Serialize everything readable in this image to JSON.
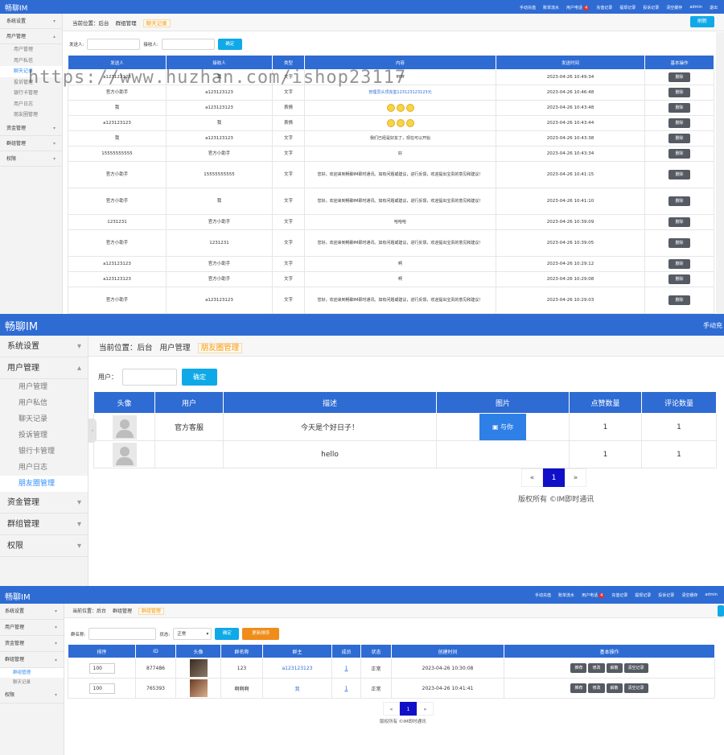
{
  "brand": "畅聊IM",
  "watermark": "https://www.huzhan.com/ishop23117",
  "nav": {
    "items": [
      "手动充值",
      "账单流水",
      "用户电话",
      "充值记录",
      "提现记录",
      "投诉记录",
      "清空缓存",
      "admin",
      "退出"
    ],
    "badge": "4"
  },
  "nav_short": "手动充",
  "s1": {
    "sidebar": {
      "group1": "系统设置",
      "group2": "用户管理",
      "items": [
        "用户管理",
        "用户私信",
        "聊天记录",
        "投诉管理",
        "银行卡管理",
        "用户日志",
        "朋友圈管理"
      ],
      "group3": "资金管理",
      "group4": "群组管理",
      "group5": "权限"
    },
    "crumb": [
      "当前位置：后台",
      "群组管理",
      "聊天记录"
    ],
    "refresh": "刷新",
    "filter": {
      "sender_label": "发送人:",
      "receiver_label": "接收人:",
      "confirm": "确定"
    },
    "headers": [
      "发送人",
      "接收人",
      "类型",
      "内容",
      "发送时间",
      "基本操作"
    ],
    "delete": "删除",
    "rows": [
      {
        "sender": "a123123123",
        "receiver": "我",
        "type": "文字",
        "content": "ffffff",
        "time": "2023-04-26 10:49:34"
      },
      {
        "sender": "官方小助手",
        "receiver": "a123123123",
        "type": "文字",
        "content": "管理员头顶完善123123123123元",
        "time": "2023-04-26 10:46:48"
      },
      {
        "sender": "我",
        "receiver": "a123123123",
        "type": "表情",
        "content": "",
        "time": "2023-04-26 10:43:48"
      },
      {
        "sender": "a123123123",
        "receiver": "我",
        "type": "表情",
        "content": "",
        "time": "2023-04-26 10:43:44"
      },
      {
        "sender": "我",
        "receiver": "a123123123",
        "type": "文字",
        "content": "我们已经是好友了，现在可以开始",
        "time": "2023-04-26 10:43:38"
      },
      {
        "sender": "15555555555",
        "receiver": "官方小助手",
        "type": "文字",
        "content": "好",
        "time": "2023-04-26 10:43:34"
      },
      {
        "sender": "官方小助手",
        "receiver": "15555555555",
        "type": "文字",
        "content": "您好，欢迎来到畅聊IM即时通讯。如有问题或建议，进行反馈，欢迎提出宝贵的意见和建议！",
        "time": "2023-04-26 10:41:15"
      },
      {
        "sender": "官方小助手",
        "receiver": "我",
        "type": "文字",
        "content": "您好，欢迎来到畅聊IM即时通讯。如有问题或建议，进行反馈，欢迎提出宝贵的意见和建议！",
        "time": "2023-04-26 10:41:10"
      },
      {
        "sender": "1231231",
        "receiver": "官方小助手",
        "type": "文字",
        "content": "哈哈哈",
        "time": "2023-04-26 10:39:09"
      },
      {
        "sender": "官方小助手",
        "receiver": "1231231",
        "type": "文字",
        "content": "您好，欢迎来到畅聊IM即时通讯。如有问题或建议，进行反馈，欢迎提出宝贵的意见和建议！",
        "time": "2023-04-26 10:39:05"
      },
      {
        "sender": "a123123123",
        "receiver": "官方小助手",
        "type": "文字",
        "content": "啊",
        "time": "2023-04-26 10:29:12"
      },
      {
        "sender": "a123123123",
        "receiver": "官方小助手",
        "type": "文字",
        "content": "啊",
        "time": "2023-04-26 10:29:08"
      },
      {
        "sender": "官方小助手",
        "receiver": "a123123123",
        "type": "文字",
        "content": "您好，欢迎来到畅聊IM即时通讯。如有问题或建议，进行反馈，欢迎提出宝贵的意见和建议！",
        "time": "2023-04-26 10:29:03"
      }
    ]
  },
  "s2": {
    "crumb": [
      "当前位置：后台",
      "用户管理",
      "朋友圈管理"
    ],
    "filter": {
      "user_label": "用户：",
      "confirm": "确定"
    },
    "headers": [
      "头像",
      "用户",
      "描述",
      "图片",
      "点赞数量",
      "评论数量"
    ],
    "rows": [
      {
        "user": "官方客服",
        "desc": "今天是个好日子！",
        "image": "与你",
        "likes": "1",
        "comments": "1"
      },
      {
        "user": "",
        "desc": "hello",
        "image": "",
        "likes": "1",
        "comments": "1"
      }
    ],
    "pager": {
      "prev": "«",
      "page": "1",
      "next": "»"
    },
    "copyright": "版权所有 ©IM即时通讯"
  },
  "s3": {
    "sidebar": {
      "group1": "系统设置",
      "group2": "用户管理",
      "group3": "资金管理",
      "group4": "群组管理",
      "items": [
        "群组管理",
        "聊天记录"
      ],
      "group5": "权限"
    },
    "crumb": [
      "当前位置：后台",
      "群组管理",
      "群组管理"
    ],
    "filter": {
      "name_label": "群名称:",
      "status_label": "状态:",
      "status_value": "正常",
      "confirm": "确定",
      "reorder": "更新排序"
    },
    "headers": [
      "排序",
      "ID",
      "头像",
      "群名称",
      "群主",
      "成员",
      "状态",
      "创建时间",
      "基本操作"
    ],
    "ops": [
      "推荐",
      "修改",
      "解散",
      "清空记录"
    ],
    "rows": [
      {
        "sort": "100",
        "id": "877486",
        "name": "123",
        "owner": "a123123123",
        "members": "1",
        "status": "正常",
        "time": "2023-04-26 10:30:08"
      },
      {
        "sort": "100",
        "id": "765393",
        "name": "啊啊啊",
        "owner": "我",
        "members": "1",
        "status": "正常",
        "time": "2023-04-26 10:41:41"
      }
    ],
    "pager": {
      "prev": "«",
      "page": "1",
      "next": "»"
    },
    "copyright": "版权所有 ©IM即时通讯"
  },
  "colors": {
    "header": "#2e6bd3",
    "accent": "#0fa9e8",
    "orange": "#f08c1a",
    "delete": "#555a63"
  }
}
